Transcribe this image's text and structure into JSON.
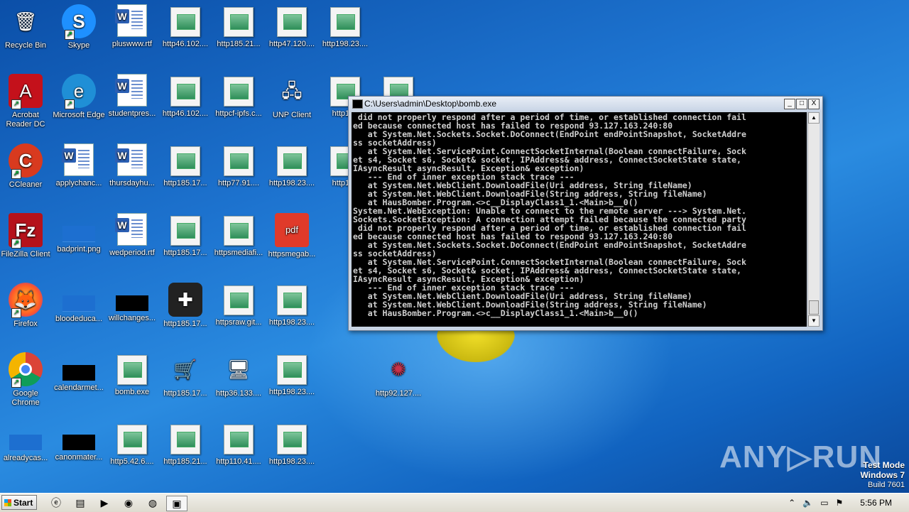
{
  "desktop": {
    "icons": [
      {
        "label": "Recycle Bin",
        "kind": "recycle"
      },
      {
        "label": "Skype",
        "kind": "skype"
      },
      {
        "label": "pluswww.rtf",
        "kind": "word"
      },
      {
        "label": "http46.102....",
        "kind": "file"
      },
      {
        "label": "http185.21...",
        "kind": "file"
      },
      {
        "label": "http47.120....",
        "kind": "file"
      },
      {
        "label": "http198.23....",
        "kind": "file"
      },
      {
        "label": "Acrobat Reader DC",
        "kind": "acrobat"
      },
      {
        "label": "Microsoft Edge",
        "kind": "edge"
      },
      {
        "label": "studentpres...",
        "kind": "word"
      },
      {
        "label": "http46.102....",
        "kind": "file"
      },
      {
        "label": "httpcf-ipfs.c...",
        "kind": "file"
      },
      {
        "label": "UNP Client",
        "kind": "unp"
      },
      {
        "label": "http198",
        "kind": "file"
      },
      {
        "label": "",
        "kind": "file"
      },
      {
        "label": "CCleaner",
        "kind": "ccleaner"
      },
      {
        "label": "applychanc...",
        "kind": "word"
      },
      {
        "label": "thursdayhu...",
        "kind": "word"
      },
      {
        "label": "http185.17...",
        "kind": "file"
      },
      {
        "label": "http77.91....",
        "kind": "file"
      },
      {
        "label": "http198.23....",
        "kind": "file"
      },
      {
        "label": "http198",
        "kind": "file"
      },
      {
        "label": "FileZilla Client",
        "kind": "filezilla"
      },
      {
        "label": "badprint.png",
        "kind": "blue"
      },
      {
        "label": "wedperiod.rtf",
        "kind": "word"
      },
      {
        "label": "http185.17...",
        "kind": "file"
      },
      {
        "label": "httpsmediafi...",
        "kind": "file"
      },
      {
        "label": "httpsmegab...",
        "kind": "pdf"
      },
      {
        "label": "Firefox",
        "kind": "firefox"
      },
      {
        "label": "bloodeduca...",
        "kind": "blue"
      },
      {
        "label": "willchanges...",
        "kind": "black"
      },
      {
        "label": "http185.17...",
        "kind": "bottle"
      },
      {
        "label": "httpsraw.git...",
        "kind": "file"
      },
      {
        "label": "http198.23....",
        "kind": "file"
      },
      {
        "label": "Google Chrome",
        "kind": "chrome"
      },
      {
        "label": "calendarmet...",
        "kind": "black"
      },
      {
        "label": "bomb.exe",
        "kind": "file"
      },
      {
        "label": "http185.17...",
        "kind": "cart"
      },
      {
        "label": "http36.133....",
        "kind": "monitor"
      },
      {
        "label": "http198.23....",
        "kind": "file"
      },
      {
        "label": "http92.127....",
        "kind": "spider"
      },
      {
        "label": "alreadycas...",
        "kind": "blue"
      },
      {
        "label": "canonmater...",
        "kind": "black"
      },
      {
        "label": "http5.42.6....",
        "kind": "file"
      },
      {
        "label": "http185.21...",
        "kind": "file"
      },
      {
        "label": "http110.41....",
        "kind": "file"
      },
      {
        "label": "http198.23....",
        "kind": "file"
      }
    ]
  },
  "console": {
    "title": "C:\\Users\\admin\\Desktop\\bomb.exe",
    "minimize": "_",
    "maximize": "□",
    "close": "X",
    "output": " did not properly respond after a period of time, or established connection fail\ned because connected host has failed to respond 93.127.163.240:80\n   at System.Net.Sockets.Socket.DoConnect(EndPoint endPointSnapshot, SocketAddre\nss socketAddress)\n   at System.Net.ServicePoint.ConnectSocketInternal(Boolean connectFailure, Sock\net s4, Socket s6, Socket& socket, IPAddress& address, ConnectSocketState state,\nIAsyncResult asyncResult, Exception& exception)\n   --- End of inner exception stack trace ---\n   at System.Net.WebClient.DownloadFile(Uri address, String fileName)\n   at System.Net.WebClient.DownloadFile(String address, String fileName)\n   at HausBomber.Program.<>c__DisplayClass1_1.<Main>b__0()\nSystem.Net.WebException: Unable to connect to the remote server ---> System.Net.\nSockets.SocketException: A connection attempt failed because the connected party\n did not properly respond after a period of time, or established connection fail\ned because connected host has failed to respond 93.127.163.240:80\n   at System.Net.Sockets.Socket.DoConnect(EndPoint endPointSnapshot, SocketAddre\nss socketAddress)\n   at System.Net.ServicePoint.ConnectSocketInternal(Boolean connectFailure, Sock\net s4, Socket s6, Socket& socket, IPAddress& address, ConnectSocketState state,\nIAsyncResult asyncResult, Exception& exception)\n   --- End of inner exception stack trace ---\n   at System.Net.WebClient.DownloadFile(Uri address, String fileName)\n   at System.Net.WebClient.DownloadFile(String address, String fileName)\n   at HausBomber.Program.<>c__DisplayClass1_1.<Main>b__0()"
  },
  "watermark": "ANY▷RUN",
  "os_info": {
    "line1": "Test Mode",
    "line2": "Windows 7",
    "line3": "Build 7601"
  },
  "taskbar": {
    "start_label": "Start",
    "clock": "5:56 PM"
  }
}
